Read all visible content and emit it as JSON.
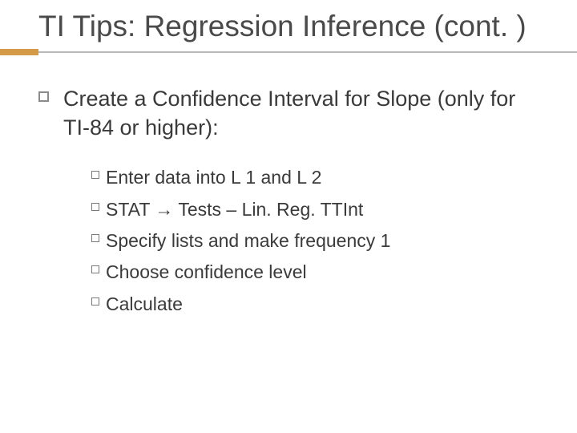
{
  "title": "TI Tips: Regression Inference (cont. )",
  "main_item": "Create a Confidence Interval for Slope (only for TI-84 or higher):",
  "sub_items": [
    {
      "first": "Enter",
      "rest": " data into L 1 and L 2"
    },
    {
      "first": "STAT",
      "rest": " Tests – Lin. Reg. TTInt",
      "arrow": true
    },
    {
      "first": "Specify",
      "rest": " lists and make frequency 1"
    },
    {
      "first": "Choose",
      "rest": " confidence level"
    },
    {
      "first": "Calculate",
      "rest": ""
    }
  ],
  "arrow_glyph": "→"
}
